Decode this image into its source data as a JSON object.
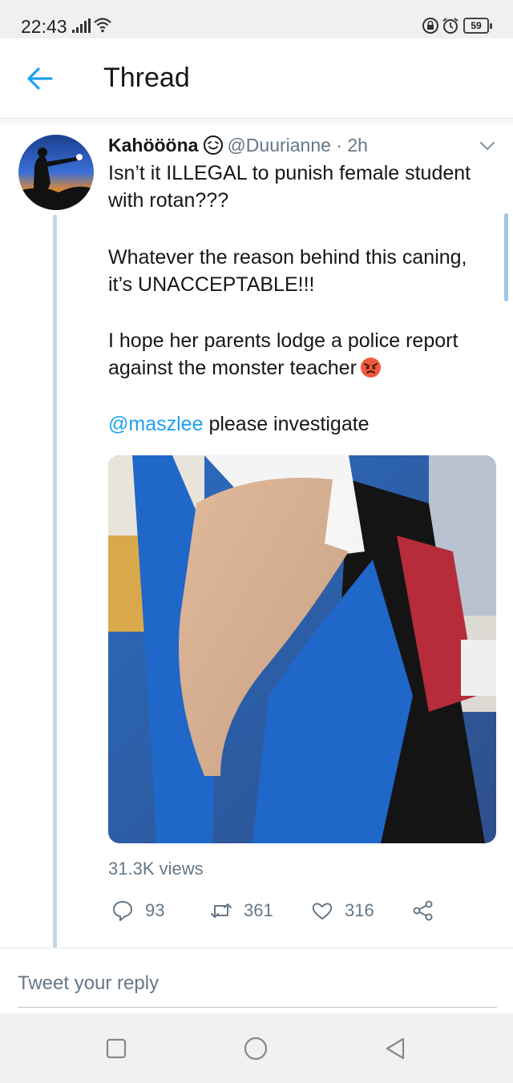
{
  "status_bar": {
    "time": "22:43",
    "battery": "59",
    "icons": [
      "signal-icon",
      "wifi-icon",
      "rotation-lock-icon",
      "alarm-icon",
      "battery-icon"
    ]
  },
  "header": {
    "title": "Thread",
    "back_icon": "arrow-left-icon"
  },
  "tweet": {
    "author": "Kahöööna",
    "handle": "@Duurianne",
    "separator": "·",
    "time": "2h",
    "text_lines": [
      "Isn’t it ILLEGAL to punish female student",
      "with rotan???",
      "Whatever the reason behind this caning,",
      "it’s UNACCEPTABLE!!!",
      "I hope her parents lodge a police report",
      "against the monster teacher"
    ],
    "mention": "@maszlee",
    "mention_rest": "please investigate",
    "emoji": "angry-face-emoji",
    "views": "31.3K views",
    "actions": {
      "replies": "93",
      "retweets": "361",
      "likes": "316"
    }
  },
  "reply": {
    "placeholder": "Tweet your reply"
  },
  "navigation": [
    "recent-apps-button",
    "home-button",
    "back-button"
  ],
  "colors": {
    "accent": "#1da1f2",
    "text": "#14171a",
    "secondary": "#657786",
    "thread_line": "#c4d4df"
  }
}
